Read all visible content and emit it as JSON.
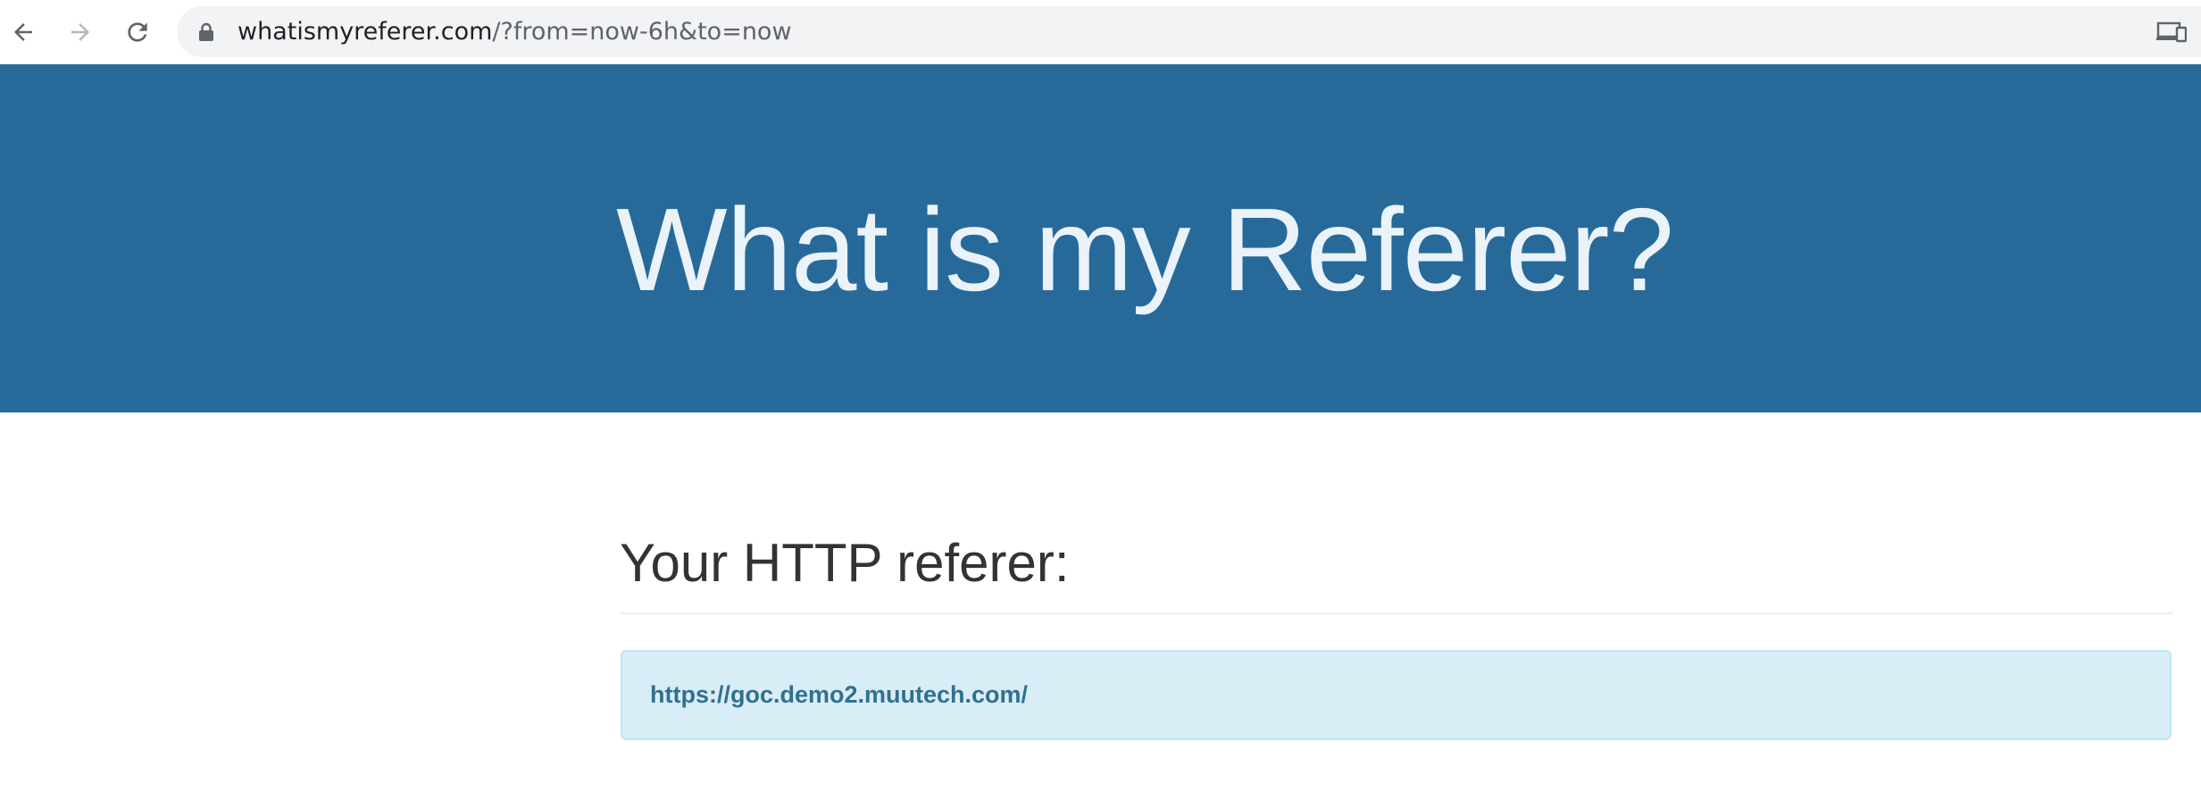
{
  "browser": {
    "url_domain": "whatismyreferer.com",
    "url_path": "/?from=now-6h&to=now",
    "icons": {
      "back": "back-arrow-icon",
      "forward": "forward-arrow-icon",
      "reload": "reload-icon",
      "lock": "lock-icon",
      "devices": "devices-icon"
    }
  },
  "hero": {
    "title": "What is my Referer?",
    "background_color": "#276a9a",
    "text_color": "#eaf3f9"
  },
  "main": {
    "heading": "Your HTTP referer:",
    "referer_value": "https://goc.demo2.muutech.com/",
    "box_color": "#d9edf7",
    "value_color": "#31708f"
  }
}
